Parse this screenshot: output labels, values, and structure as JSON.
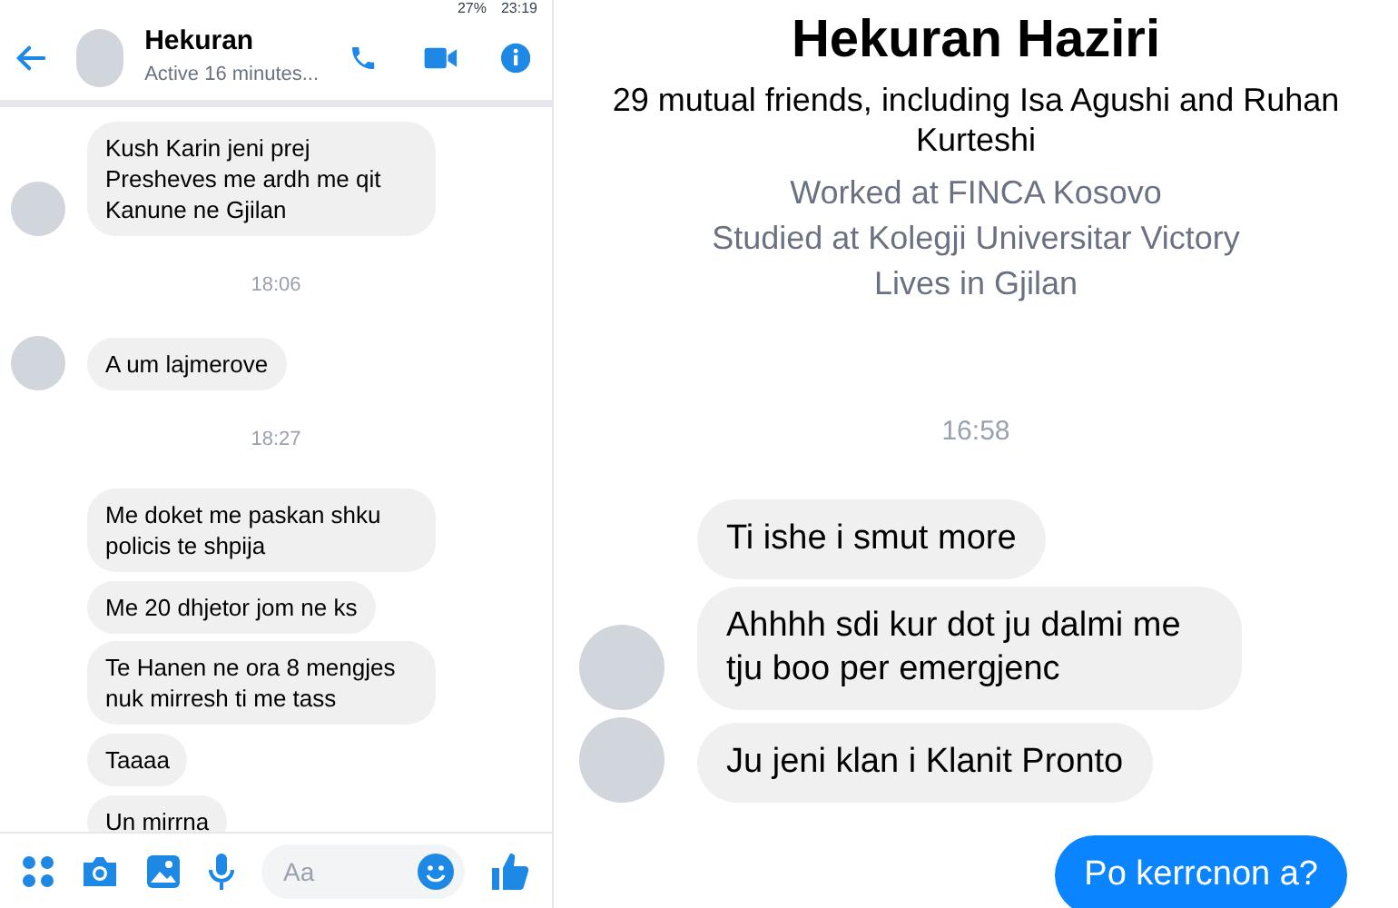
{
  "left_screen": {
    "status_bar": {
      "battery": "27%",
      "time": "23:19"
    },
    "header": {
      "name": "Hekuran",
      "status": "Active 16 minutes..."
    },
    "messages": [
      {
        "kind": "incoming",
        "text": "Kush Karin jeni prej Presheves me ardh me qit Kanune ne Gjilan",
        "avatar": true
      },
      {
        "kind": "time",
        "text": "18:06"
      },
      {
        "kind": "incoming",
        "text": "A um lajmerove",
        "avatar": true
      },
      {
        "kind": "time",
        "text": "18:27"
      },
      {
        "kind": "incoming",
        "text": "Me doket me paskan shku policis te shpija",
        "avatar": false
      },
      {
        "kind": "incoming",
        "text": "Me 20 dhjetor jom ne ks",
        "avatar": false
      },
      {
        "kind": "incoming",
        "text": "Te Hanen ne ora 8 mengjes nuk mirresh ti me tass",
        "avatar": false
      },
      {
        "kind": "incoming",
        "text": "Taaaa",
        "avatar": false
      },
      {
        "kind": "incoming",
        "text": "Un mirrna",
        "avatar": false
      }
    ],
    "composer": {
      "placeholder": "Aa"
    }
  },
  "right_screen": {
    "profile": {
      "name": "Hekuran Haziri",
      "mutual_friends": "29 mutual friends, including Isa Agushi and Ruhan Kurteshi",
      "details": [
        "Worked at FINCA Kosovo",
        "Studied at Kolegji Universitar Victory",
        "Lives in Gjilan"
      ]
    },
    "messages": [
      {
        "kind": "time",
        "text": "16:58"
      },
      {
        "kind": "incoming",
        "text": "Ti ishe i smut more",
        "avatar": false
      },
      {
        "kind": "incoming",
        "text": "Ahhhh sdi kur dot ju dalmi me tju boo per emergjenc",
        "avatar": true
      },
      {
        "kind": "incoming",
        "text": "Ju jeni klan i Klanit Pronto",
        "avatar": true
      },
      {
        "kind": "outgoing",
        "text": "Po kerrcnon a?"
      }
    ]
  }
}
